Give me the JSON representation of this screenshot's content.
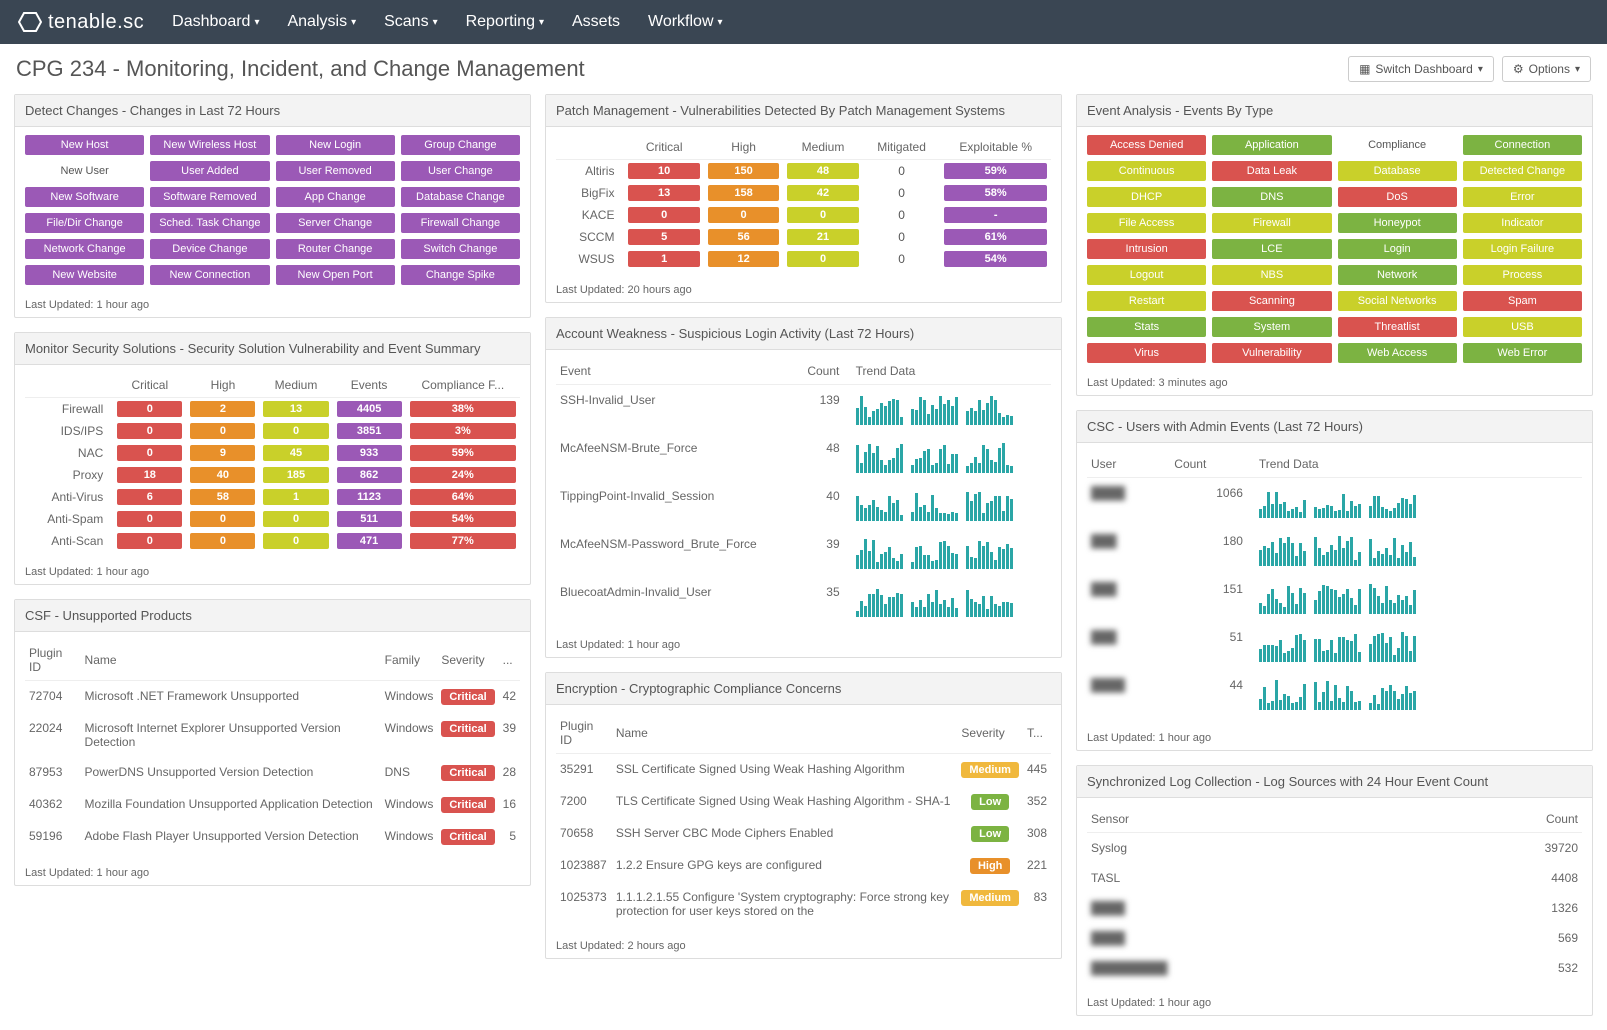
{
  "nav": {
    "brand": "tenable.sc",
    "items": [
      "Dashboard",
      "Analysis",
      "Scans",
      "Reporting",
      "Assets",
      "Workflow"
    ]
  },
  "page_title": "CPG 234 - Monitoring, Incident, and Change Management",
  "buttons": {
    "switch": "Switch Dashboard",
    "options": "Options"
  },
  "detect_changes": {
    "title": "Detect Changes - Changes in Last 72 Hours",
    "footer": "Last Updated: 1 hour ago",
    "items": [
      {
        "label": "New Host",
        "c": "c-purple"
      },
      {
        "label": "New Wireless Host",
        "c": "c-purple"
      },
      {
        "label": "New Login",
        "c": "c-purple"
      },
      {
        "label": "Group Change",
        "c": "c-purple"
      },
      {
        "label": "New User",
        "c": "plain"
      },
      {
        "label": "User Added",
        "c": "c-purple"
      },
      {
        "label": "User Removed",
        "c": "c-purple"
      },
      {
        "label": "User Change",
        "c": "c-purple"
      },
      {
        "label": "New Software",
        "c": "c-purple"
      },
      {
        "label": "Software Removed",
        "c": "c-purple"
      },
      {
        "label": "App Change",
        "c": "c-purple"
      },
      {
        "label": "Database Change",
        "c": "c-purple"
      },
      {
        "label": "File/Dir Change",
        "c": "c-purple"
      },
      {
        "label": "Sched. Task Change",
        "c": "c-purple"
      },
      {
        "label": "Server Change",
        "c": "c-purple"
      },
      {
        "label": "Firewall Change",
        "c": "c-purple"
      },
      {
        "label": "Network Change",
        "c": "c-purple"
      },
      {
        "label": "Device Change",
        "c": "c-purple"
      },
      {
        "label": "Router Change",
        "c": "c-purple"
      },
      {
        "label": "Switch Change",
        "c": "c-purple"
      },
      {
        "label": "New Website",
        "c": "c-purple"
      },
      {
        "label": "New Connection",
        "c": "c-purple"
      },
      {
        "label": "New Open Port",
        "c": "c-purple"
      },
      {
        "label": "Change Spike",
        "c": "c-purple"
      }
    ]
  },
  "monitor_security": {
    "title": "Monitor Security Solutions - Security Solution Vulnerability and Event Summary",
    "footer": "Last Updated: 1 hour ago",
    "cols": [
      "Critical",
      "High",
      "Medium",
      "Events",
      "Compliance F..."
    ],
    "rows": [
      {
        "label": "Firewall",
        "cells": [
          {
            "v": "0",
            "c": "c-red"
          },
          {
            "v": "2",
            "c": "c-orange"
          },
          {
            "v": "13",
            "c": "c-yellow"
          },
          {
            "v": "4405",
            "c": "c-purple"
          },
          {
            "v": "38%",
            "c": "c-red"
          }
        ]
      },
      {
        "label": "IDS/IPS",
        "cells": [
          {
            "v": "0",
            "c": "c-red"
          },
          {
            "v": "0",
            "c": "c-orange"
          },
          {
            "v": "0",
            "c": "c-yellow"
          },
          {
            "v": "3851",
            "c": "c-purple"
          },
          {
            "v": "3%",
            "c": "c-red"
          }
        ]
      },
      {
        "label": "NAC",
        "cells": [
          {
            "v": "0",
            "c": "c-red"
          },
          {
            "v": "9",
            "c": "c-orange"
          },
          {
            "v": "45",
            "c": "c-yellow"
          },
          {
            "v": "933",
            "c": "c-purple"
          },
          {
            "v": "59%",
            "c": "c-red"
          }
        ]
      },
      {
        "label": "Proxy",
        "cells": [
          {
            "v": "18",
            "c": "c-red"
          },
          {
            "v": "40",
            "c": "c-orange"
          },
          {
            "v": "185",
            "c": "c-yellow"
          },
          {
            "v": "862",
            "c": "c-purple"
          },
          {
            "v": "24%",
            "c": "c-red"
          }
        ]
      },
      {
        "label": "Anti-Virus",
        "cells": [
          {
            "v": "6",
            "c": "c-red"
          },
          {
            "v": "58",
            "c": "c-orange"
          },
          {
            "v": "1",
            "c": "c-yellow"
          },
          {
            "v": "1123",
            "c": "c-purple"
          },
          {
            "v": "64%",
            "c": "c-red"
          }
        ]
      },
      {
        "label": "Anti-Spam",
        "cells": [
          {
            "v": "0",
            "c": "c-red"
          },
          {
            "v": "0",
            "c": "c-orange"
          },
          {
            "v": "0",
            "c": "c-yellow"
          },
          {
            "v": "511",
            "c": "c-purple"
          },
          {
            "v": "54%",
            "c": "c-red"
          }
        ]
      },
      {
        "label": "Anti-Scan",
        "cells": [
          {
            "v": "0",
            "c": "c-red"
          },
          {
            "v": "0",
            "c": "c-orange"
          },
          {
            "v": "0",
            "c": "c-yellow"
          },
          {
            "v": "471",
            "c": "c-purple"
          },
          {
            "v": "77%",
            "c": "c-red"
          }
        ]
      }
    ]
  },
  "csf": {
    "title": "CSF - Unsupported Products",
    "footer": "Last Updated: 1 hour ago",
    "cols": [
      "Plugin ID",
      "Name",
      "Family",
      "Severity",
      "..."
    ],
    "rows": [
      {
        "id": "72704",
        "name": "Microsoft .NET Framework Unsupported",
        "family": "Windows",
        "sev": "Critical",
        "count": "42"
      },
      {
        "id": "22024",
        "name": "Microsoft Internet Explorer Unsupported Version Detection",
        "family": "Windows",
        "sev": "Critical",
        "count": "39"
      },
      {
        "id": "87953",
        "name": "PowerDNS Unsupported Version Detection",
        "family": "DNS",
        "sev": "Critical",
        "count": "28"
      },
      {
        "id": "40362",
        "name": "Mozilla Foundation Unsupported Application Detection",
        "family": "Windows",
        "sev": "Critical",
        "count": "16"
      },
      {
        "id": "59196",
        "name": "Adobe Flash Player Unsupported Version Detection",
        "family": "Windows",
        "sev": "Critical",
        "count": "5"
      }
    ]
  },
  "patch": {
    "title": "Patch Management - Vulnerabilities Detected By Patch Management Systems",
    "footer": "Last Updated: 20 hours ago",
    "cols": [
      "Critical",
      "High",
      "Medium",
      "Mitigated",
      "Exploitable %"
    ],
    "rows": [
      {
        "label": "Altiris",
        "cells": [
          {
            "v": "10",
            "c": "c-red"
          },
          {
            "v": "150",
            "c": "c-orange"
          },
          {
            "v": "48",
            "c": "c-yellow"
          },
          {
            "v": "0",
            "c": ""
          },
          {
            "v": "59%",
            "c": "c-purple"
          }
        ]
      },
      {
        "label": "BigFix",
        "cells": [
          {
            "v": "13",
            "c": "c-red"
          },
          {
            "v": "158",
            "c": "c-orange"
          },
          {
            "v": "42",
            "c": "c-yellow"
          },
          {
            "v": "0",
            "c": ""
          },
          {
            "v": "58%",
            "c": "c-purple"
          }
        ]
      },
      {
        "label": "KACE",
        "cells": [
          {
            "v": "0",
            "c": "c-red"
          },
          {
            "v": "0",
            "c": "c-orange"
          },
          {
            "v": "0",
            "c": "c-yellow"
          },
          {
            "v": "0",
            "c": ""
          },
          {
            "v": "-",
            "c": "c-purple"
          }
        ]
      },
      {
        "label": "SCCM",
        "cells": [
          {
            "v": "5",
            "c": "c-red"
          },
          {
            "v": "56",
            "c": "c-orange"
          },
          {
            "v": "21",
            "c": "c-yellow"
          },
          {
            "v": "0",
            "c": ""
          },
          {
            "v": "61%",
            "c": "c-purple"
          }
        ]
      },
      {
        "label": "WSUS",
        "cells": [
          {
            "v": "1",
            "c": "c-red"
          },
          {
            "v": "12",
            "c": "c-orange"
          },
          {
            "v": "0",
            "c": "c-yellow"
          },
          {
            "v": "0",
            "c": ""
          },
          {
            "v": "54%",
            "c": "c-purple"
          }
        ]
      }
    ]
  },
  "account_weakness": {
    "title": "Account Weakness - Suspicious Login Activity (Last 72 Hours)",
    "footer": "Last Updated: 1 hour ago",
    "cols": [
      "Event",
      "Count",
      "Trend Data"
    ],
    "rows": [
      {
        "event": "SSH-Invalid_User",
        "count": "139"
      },
      {
        "event": "McAfeeNSM-Brute_Force",
        "count": "48"
      },
      {
        "event": "TippingPoint-Invalid_Session",
        "count": "40"
      },
      {
        "event": "McAfeeNSM-Password_Brute_Force",
        "count": "39"
      },
      {
        "event": "BluecoatAdmin-Invalid_User",
        "count": "35"
      }
    ]
  },
  "encryption": {
    "title": "Encryption - Cryptographic Compliance Concerns",
    "footer": "Last Updated: 2 hours ago",
    "cols": [
      "Plugin ID",
      "Name",
      "Severity",
      "T..."
    ],
    "rows": [
      {
        "id": "35291",
        "name": "SSL Certificate Signed Using Weak Hashing Algorithm",
        "sev": "Medium",
        "count": "445"
      },
      {
        "id": "7200",
        "name": "TLS Certificate Signed Using Weak Hashing Algorithm - SHA-1",
        "sev": "Low",
        "count": "352"
      },
      {
        "id": "70658",
        "name": "SSH Server CBC Mode Ciphers Enabled",
        "sev": "Low",
        "count": "308"
      },
      {
        "id": "1023887",
        "name": "1.2.2 Ensure GPG keys are configured",
        "sev": "High",
        "count": "221"
      },
      {
        "id": "1025373",
        "name": "1.1.1.2.1.55 Configure 'System cryptography: Force strong key protection for user keys stored on the",
        "sev": "Medium",
        "count": "83"
      }
    ]
  },
  "event_analysis": {
    "title": "Event Analysis - Events By Type",
    "footer": "Last Updated: 3 minutes ago",
    "items": [
      {
        "label": "Access Denied",
        "c": "c-red"
      },
      {
        "label": "Application",
        "c": "c-green"
      },
      {
        "label": "Compliance",
        "c": "c-white"
      },
      {
        "label": "Connection",
        "c": "c-green"
      },
      {
        "label": "Continuous",
        "c": "c-yellow"
      },
      {
        "label": "Data Leak",
        "c": "c-red"
      },
      {
        "label": "Database",
        "c": "c-yellow"
      },
      {
        "label": "Detected Change",
        "c": "c-yellow"
      },
      {
        "label": "DHCP",
        "c": "c-yellow"
      },
      {
        "label": "DNS",
        "c": "c-green"
      },
      {
        "label": "DoS",
        "c": "c-red"
      },
      {
        "label": "Error",
        "c": "c-yellow"
      },
      {
        "label": "File Access",
        "c": "c-yellow"
      },
      {
        "label": "Firewall",
        "c": "c-yellow"
      },
      {
        "label": "Honeypot",
        "c": "c-green"
      },
      {
        "label": "Indicator",
        "c": "c-yellow"
      },
      {
        "label": "Intrusion",
        "c": "c-red"
      },
      {
        "label": "LCE",
        "c": "c-green"
      },
      {
        "label": "Login",
        "c": "c-green"
      },
      {
        "label": "Login Failure",
        "c": "c-yellow"
      },
      {
        "label": "Logout",
        "c": "c-yellow"
      },
      {
        "label": "NBS",
        "c": "c-yellow"
      },
      {
        "label": "Network",
        "c": "c-green"
      },
      {
        "label": "Process",
        "c": "c-yellow"
      },
      {
        "label": "Restart",
        "c": "c-yellow"
      },
      {
        "label": "Scanning",
        "c": "c-red"
      },
      {
        "label": "Social Networks",
        "c": "c-yellow"
      },
      {
        "label": "Spam",
        "c": "c-red"
      },
      {
        "label": "Stats",
        "c": "c-green"
      },
      {
        "label": "System",
        "c": "c-green"
      },
      {
        "label": "Threatlist",
        "c": "c-red"
      },
      {
        "label": "USB",
        "c": "c-yellow"
      },
      {
        "label": "Virus",
        "c": "c-red"
      },
      {
        "label": "Vulnerability",
        "c": "c-red"
      },
      {
        "label": "Web Access",
        "c": "c-green"
      },
      {
        "label": "Web Error",
        "c": "c-green"
      }
    ]
  },
  "csc": {
    "title": "CSC - Users with Admin Events (Last 72 Hours)",
    "footer": "Last Updated: 1 hour ago",
    "cols": [
      "User",
      "Count",
      "Trend Data"
    ],
    "rows": [
      {
        "user": "████",
        "count": "1066"
      },
      {
        "user": "███",
        "count": "180"
      },
      {
        "user": "███",
        "count": "151"
      },
      {
        "user": "███",
        "count": "51"
      },
      {
        "user": "████",
        "count": "44"
      }
    ]
  },
  "syncd_log": {
    "title": "Synchronized Log Collection - Log Sources with 24 Hour Event Count",
    "footer": "Last Updated: 1 hour ago",
    "cols": [
      "Sensor",
      "Count"
    ],
    "rows": [
      {
        "sensor": "Syslog",
        "count": "39720",
        "blur": false
      },
      {
        "sensor": "TASL",
        "count": "4408",
        "blur": false
      },
      {
        "sensor": "████",
        "count": "1326",
        "blur": true
      },
      {
        "sensor": "████",
        "count": "569",
        "blur": true
      },
      {
        "sensor": "█████████",
        "count": "532",
        "blur": true
      }
    ]
  }
}
